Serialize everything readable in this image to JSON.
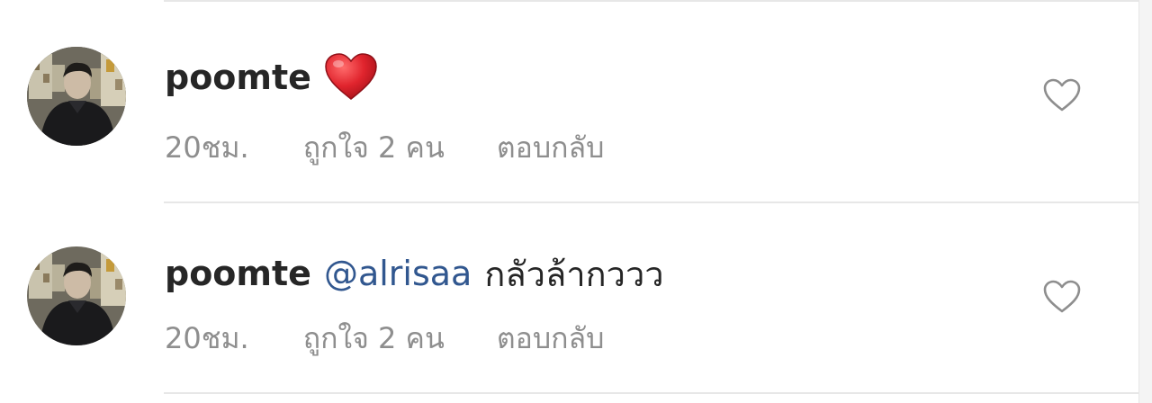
{
  "comments": [
    {
      "username": "poomte",
      "mention": "",
      "text": "",
      "emoji": "red-heart-emoji",
      "time": "20ชม.",
      "likes": "ถูกใจ 2 คน",
      "reply": "ตอบกลับ",
      "like_icon": "heart-outline-icon"
    },
    {
      "username": "poomte",
      "mention": "@alrisaa",
      "text": "กลัวล้ากววว",
      "emoji": "",
      "time": "20ชม.",
      "likes": "ถูกใจ 2 คน",
      "reply": "ตอบกลับ",
      "like_icon": "heart-outline-icon"
    }
  ],
  "colors": {
    "text": "#262626",
    "secondary": "#8e8e8e",
    "mention": "#31578f",
    "divider": "#e7e7e7",
    "emoji_heart": "#e0242d"
  }
}
